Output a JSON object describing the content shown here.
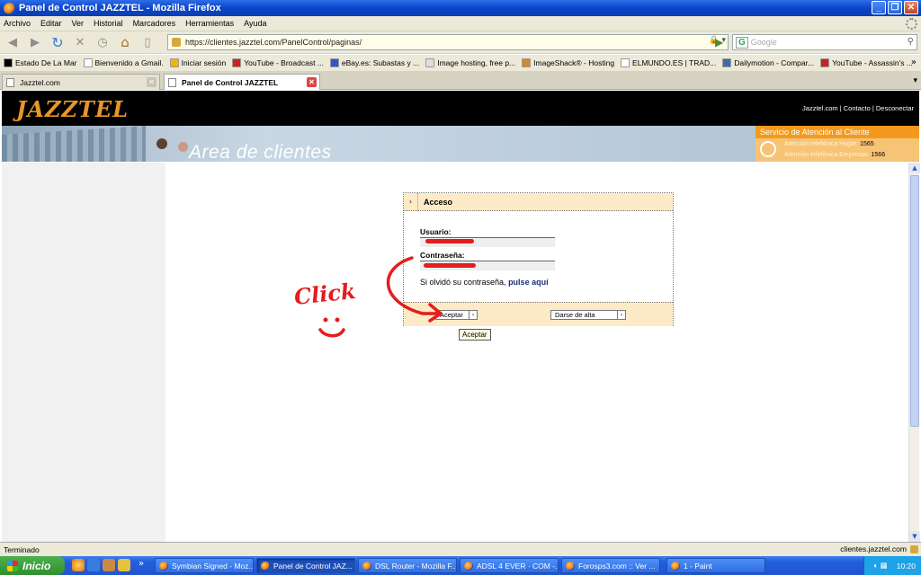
{
  "window": {
    "title": "Panel de Control JAZZTEL - Mozilla Firefox"
  },
  "menu": [
    "Archivo",
    "Editar",
    "Ver",
    "Historial",
    "Marcadores",
    "Herramientas",
    "Ayuda"
  ],
  "navbar": {
    "url": "https://clientes.jazztel.com/PanelControl/paginas/",
    "search_placeholder": "Google"
  },
  "bookmarks": [
    {
      "label": "Estado De La Mar",
      "icon": "n-icon",
      "color": "#000000"
    },
    {
      "label": "Bienvenido a Gmail.",
      "icon": "g-icon",
      "color": "#ffffff"
    },
    {
      "label": "Iniciar sesión",
      "icon": "windows-flag-icon",
      "color": "#f4b400"
    },
    {
      "label": "YouTube - Broadcast ...",
      "icon": "youtube-icon",
      "color": "#cc2222"
    },
    {
      "label": "eBay.es: Subastas y ...",
      "icon": "ebay-icon",
      "color": "#3355cc"
    },
    {
      "label": "Image hosting, free p...",
      "icon": "imageshack-icon",
      "color": "#dddddd"
    },
    {
      "label": "ImageShack® - Hosting",
      "icon": "frog-icon",
      "color": "#d28a2a"
    },
    {
      "label": "ELMUNDO.ES | TRAD...",
      "icon": "doc-icon",
      "color": "#ffffff"
    },
    {
      "label": "Dailymotion - Compar...",
      "icon": "dailymotion-icon",
      "color": "#3a6ea8"
    },
    {
      "label": "YouTube - Assassin's ...",
      "icon": "youtube-icon",
      "color": "#cc2222"
    }
  ],
  "tabs": [
    {
      "label": "Jazztel.com",
      "active": false
    },
    {
      "label": "Panel de Control JAZZTEL",
      "active": true
    }
  ],
  "site": {
    "logo": "JAZZTEL",
    "top_links": "Jazztel.com  |  Contacto  |  Desconectar",
    "banner_title": "Area de clientes",
    "service": {
      "title": "Servicio de Atención al Cliente",
      "home_label": "Atención telefónica Hogar:",
      "home_number": "1565",
      "business_label": "Atención telefónica Empresas:",
      "business_number": "1566"
    }
  },
  "login": {
    "title": "Acceso",
    "user_label": "Usuario:",
    "password_label": "Contraseña:",
    "forgot_text": "Si olvidó su contraseña, ",
    "forgot_link": "pulse aquí",
    "accept_button": "Aceptar",
    "register_button": "Darse de alta",
    "tooltip": "Aceptar"
  },
  "annotation": {
    "text": "Click",
    "color": "#e41d1d"
  },
  "status": {
    "left": "Terminado",
    "right": "clientes.jazztel.com"
  },
  "taskbar": {
    "start": "Inicio",
    "tasks": [
      {
        "label": "Symbian Signed - Moz...",
        "active": false
      },
      {
        "label": "Panel de Control JAZ...",
        "active": true
      },
      {
        "label": "DSL Router - Mozilla F...",
        "active": false
      },
      {
        "label": "ADSL 4 EVER · COM -...",
        "active": false
      },
      {
        "label": "Forosps3.com :: Ver ...",
        "active": false
      },
      {
        "label": "1 - Paint",
        "active": false
      }
    ],
    "clock": "10:20"
  }
}
